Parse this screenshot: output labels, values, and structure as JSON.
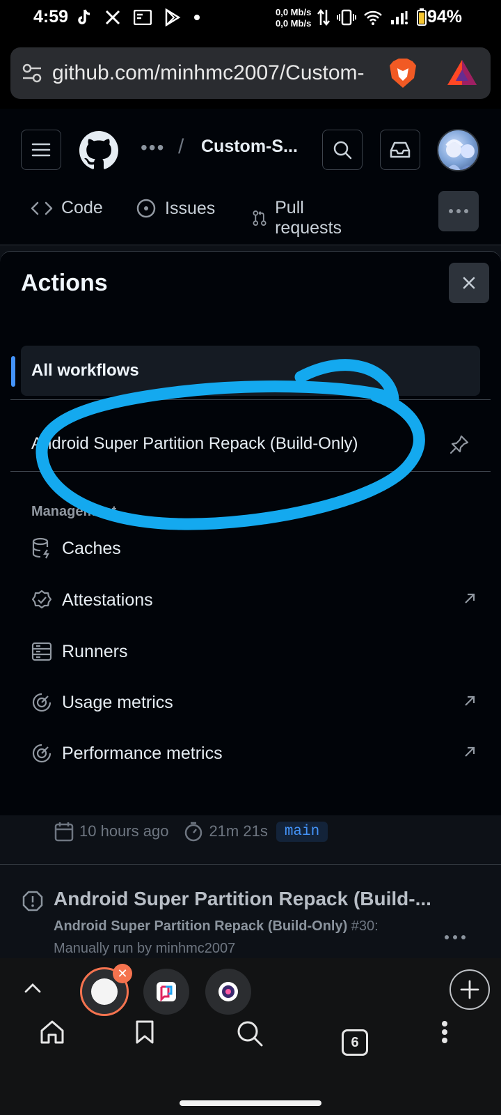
{
  "status_bar": {
    "time": "4:59",
    "net_up": "0,0 Mb/s",
    "net_down": "0,0 Mb/s",
    "battery": "94%"
  },
  "browser": {
    "url": "github.com/minhmc2007/Custom-",
    "tab_count": "6"
  },
  "header": {
    "breadcrumb_more": "•••",
    "breadcrumb_separator": "/",
    "repo": "Custom-S..."
  },
  "repo_tabs": [
    {
      "label": "Code"
    },
    {
      "label": "Issues"
    },
    {
      "label": "Pull requests"
    }
  ],
  "sheet": {
    "title": "Actions",
    "all_workflows": "All workflows",
    "workflow": "Android Super Partition Repack (Build-Only)",
    "section_label": "Management",
    "items": [
      {
        "label": "Caches",
        "icon": "database-icon",
        "external": false
      },
      {
        "label": "Attestations",
        "icon": "verified-icon",
        "external": true
      },
      {
        "label": "Runners",
        "icon": "server-icon",
        "external": false
      },
      {
        "label": "Usage metrics",
        "icon": "meter-icon",
        "external": true
      },
      {
        "label": "Performance metrics",
        "icon": "meter-icon",
        "external": true
      }
    ]
  },
  "runs": {
    "meta_time": "10 hours ago",
    "meta_duration": "21m 21s",
    "meta_branch": "main",
    "run_title": "Android Super Partition Repack (Build-...",
    "run_workflow": "Android Super Partition Repack (Build-Only)",
    "run_number": " #30:",
    "run_actor": "Manually run by minhmc2007"
  },
  "colors": {
    "accent": "#4493f8",
    "annotation": "#14a9ef",
    "brave_orange": "#f5734f"
  }
}
